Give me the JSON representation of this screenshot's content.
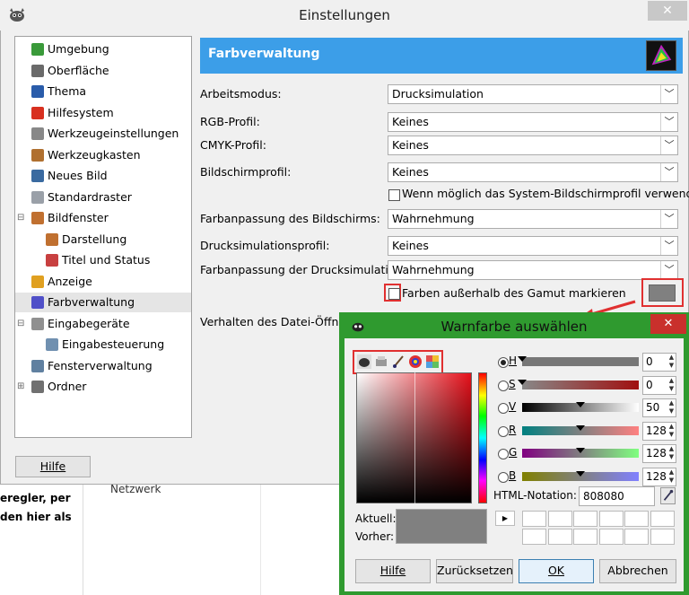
{
  "background": {
    "text_line1": "eregler, per",
    "text_line2": "den hier als",
    "network_label": "Netzwerk"
  },
  "window": {
    "title": "Einstellungen",
    "close_label": "✕"
  },
  "nav": {
    "items": [
      {
        "label": "Umgebung",
        "color": "#3a9a3a",
        "expander": ""
      },
      {
        "label": "Oberfläche",
        "color": "#6a6a6a",
        "expander": ""
      },
      {
        "label": "Thema",
        "color": "#2a5caa",
        "expander": ""
      },
      {
        "label": "Hilfesystem",
        "color": "#d83020",
        "expander": ""
      },
      {
        "label": "Werkzeugeinstellungen",
        "color": "#888888",
        "expander": ""
      },
      {
        "label": "Werkzeugkasten",
        "color": "#b07030",
        "expander": ""
      },
      {
        "label": "Neues Bild",
        "color": "#3a6aa0",
        "expander": ""
      },
      {
        "label": "Standardraster",
        "color": "#9aa0a8",
        "expander": ""
      },
      {
        "label": "Bildfenster",
        "color": "#c07030",
        "expander": "⊟"
      },
      {
        "label": "Darstellung",
        "color": "#c07030",
        "expander": ""
      },
      {
        "label": "Titel und Status",
        "color": "#c84040",
        "expander": ""
      },
      {
        "label": "Anzeige",
        "color": "#e0a020",
        "expander": ""
      },
      {
        "label": "Farbverwaltung",
        "color": "#5050c8",
        "expander": ""
      },
      {
        "label": "Eingabegeräte",
        "color": "#909090",
        "expander": "⊟"
      },
      {
        "label": "Eingabesteuerung",
        "color": "#7090b0",
        "expander": ""
      },
      {
        "label": "Fensterverwaltung",
        "color": "#6080a0",
        "expander": ""
      },
      {
        "label": "Ordner",
        "color": "#707070",
        "expander": "⊞"
      }
    ],
    "help_label": "Hilfe"
  },
  "panel": {
    "title": "Farbverwaltung",
    "rows": [
      {
        "label": "Arbeitsmodus:",
        "value": "Drucksimulation"
      },
      {
        "label": "RGB-Profil:",
        "value": "Keines"
      },
      {
        "label": "CMYK-Profil:",
        "value": "Keines"
      },
      {
        "label": "Bildschirmprofil:",
        "value": "Keines"
      },
      {
        "label": "Farbanpassung des Bildschirms:",
        "value": "Wahrnehmung"
      },
      {
        "label": "Drucksimulationsprofil:",
        "value": "Keines"
      },
      {
        "label": "Farbanpassung der Drucksimulation:",
        "value": "Wahrnehmung"
      }
    ],
    "system_profile_check": "Wenn möglich das System-Bildschirmprofil verwenden",
    "gamut_check": "Farben außerhalb des Gamut markieren",
    "open_behavior_label": "Verhalten des Datei-Öffnen-",
    "warn_color": "#808080"
  },
  "color_dialog": {
    "title": "Warnfarbe auswählen",
    "close_label": "✕",
    "channels": [
      {
        "label": "H",
        "value": "0",
        "marker": 0.0,
        "checked": true
      },
      {
        "label": "S",
        "value": "0",
        "marker": 0.0,
        "checked": false
      },
      {
        "label": "V",
        "value": "50",
        "marker": 0.5,
        "checked": false
      },
      {
        "label": "R",
        "value": "128",
        "marker": 0.5,
        "checked": false
      },
      {
        "label": "G",
        "value": "128",
        "marker": 0.5,
        "checked": false
      },
      {
        "label": "B",
        "value": "128",
        "marker": 0.5,
        "checked": false
      }
    ],
    "html_label": "HTML-Notation:",
    "html_value": "808080",
    "current_label": "Aktuell:",
    "previous_label": "Vorher:",
    "current_color": "#808080",
    "buttons": {
      "help": "Hilfe",
      "reset": "Zurücksetzen",
      "ok": "OK",
      "cancel": "Abbrechen"
    }
  }
}
